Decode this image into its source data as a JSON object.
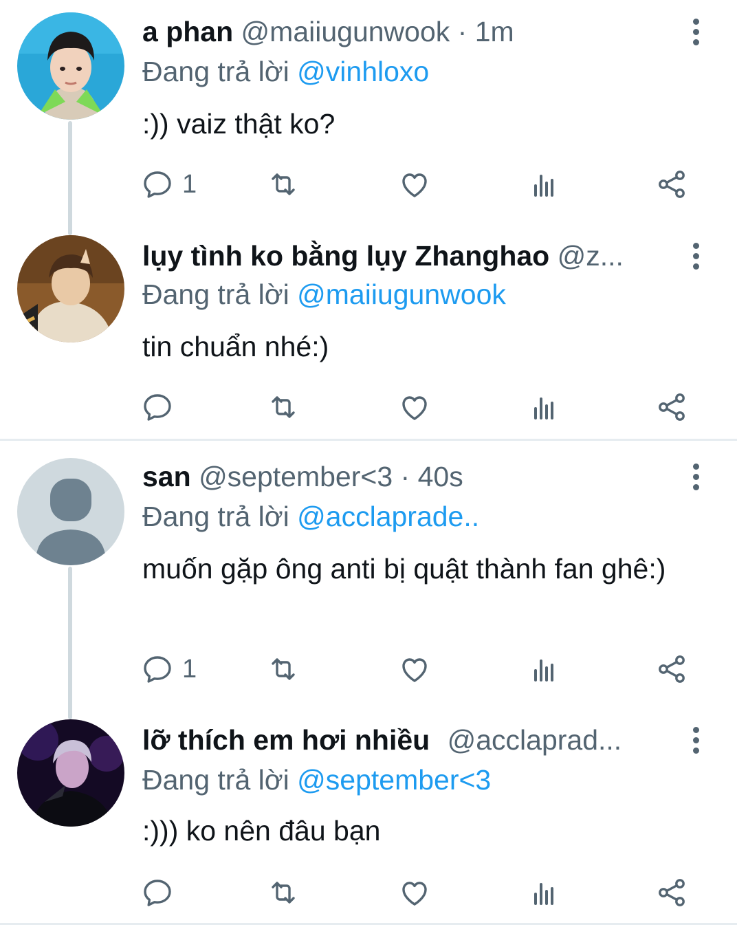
{
  "colors": {
    "link": "#1d9bf0",
    "muted": "#536471",
    "text": "#0f1419",
    "thread_line": "#cfd9de",
    "divider": "#e6ecf0"
  },
  "icons": {
    "reply": "reply-icon",
    "retweet": "retweet-icon",
    "like": "heart-icon",
    "views": "analytics-icon",
    "share": "share-icon",
    "more": "more-vertical-icon"
  },
  "tweets": [
    {
      "name": "a phan",
      "handle": "@maiiugunwook",
      "separator": "·",
      "time": "1m",
      "reply_prefix": "Đang trả lời",
      "reply_to": "@vinhloxo",
      "text": ":)) vaiz thật ko?",
      "reply_count": "1"
    },
    {
      "name": "lụy tình ko bằng lụy Zhanghao",
      "handle": "@z...",
      "separator": "",
      "time": "",
      "reply_prefix": "Đang trả lời",
      "reply_to": "@maiiugunwook",
      "text": "tin chuẩn nhé:)",
      "reply_count": ""
    },
    {
      "name": "san",
      "handle": "@september<3",
      "separator": "·",
      "time": "40s",
      "reply_prefix": "Đang trả lời",
      "reply_to": "@acclaprade..",
      "text": "muốn gặp ông anti bị quật thành fan ghê:)",
      "reply_count": "1"
    },
    {
      "name": "lỡ thích em hơi nhiều",
      "handle": "@acclaprad...",
      "separator": "",
      "time": "",
      "reply_prefix": "Đang trả lời",
      "reply_to": "@september<3",
      "text": ":))) ko nên đâu bạn",
      "reply_count": ""
    }
  ]
}
